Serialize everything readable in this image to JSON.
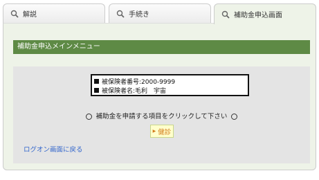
{
  "tabs": [
    {
      "label": "解説",
      "icon": "magnifier-icon",
      "active": false
    },
    {
      "label": "手続き",
      "icon": "magnifier-icon",
      "active": false
    },
    {
      "label": "補助金申込画面",
      "icon": "magnifier-icon",
      "active": true
    }
  ],
  "menu": {
    "title": "補助金申込メインメニュー"
  },
  "info": {
    "insured_number": "被保険者番号:2000-9999",
    "insured_name": "被保険者名:毛利　宇宙"
  },
  "instruction": "補助金を申請する項目をクリックして下さい",
  "button": {
    "label": "健診"
  },
  "link": {
    "logon": "ログオン画面に戻る"
  },
  "colors": {
    "menu_bar": "#5e8a45",
    "active_tab": "#eef3e8",
    "gray_area": "#e4e4e4",
    "button_bg": "#ffffcc",
    "button_text": "#d27a1a",
    "link": "#3366cc"
  }
}
